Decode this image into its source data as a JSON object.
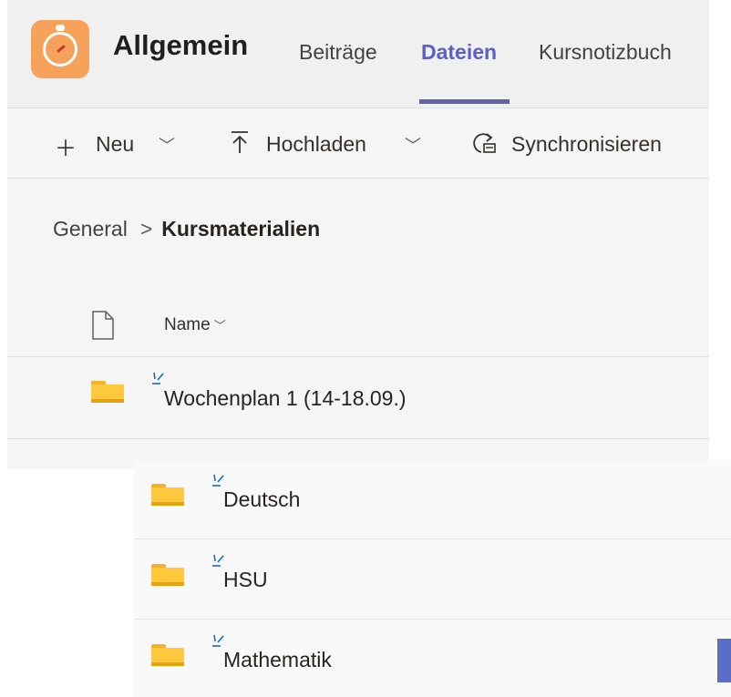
{
  "header": {
    "team_name": "Allgemein",
    "app_icon": "compass-app-icon",
    "tabs": [
      {
        "label": "Beiträge",
        "active": false
      },
      {
        "label": "Dateien",
        "active": true
      },
      {
        "label": "Kursnotizbuch",
        "active": false
      }
    ],
    "accent_color": "#6264a7"
  },
  "toolbar": {
    "new_label": "Neu",
    "upload_label": "Hochladen",
    "sync_label": "Synchronisieren",
    "icons": [
      "plus-icon",
      "upload-icon",
      "sync-icon",
      "chevron-down-icon"
    ]
  },
  "breadcrumb": {
    "root": "General",
    "current": "Kursmaterialien"
  },
  "list_header": {
    "name_column": "Name",
    "icon": "file-type-icon"
  },
  "folders": [
    {
      "name": "Wochenplan 1 (14-18.09.)",
      "icon": "folder-icon",
      "is_new": true
    },
    {
      "name": "Deutsch",
      "icon": "folder-icon",
      "is_new": true
    },
    {
      "name": "HSU",
      "icon": "folder-icon",
      "is_new": true
    },
    {
      "name": "Mathematik",
      "icon": "folder-icon",
      "is_new": true
    }
  ]
}
